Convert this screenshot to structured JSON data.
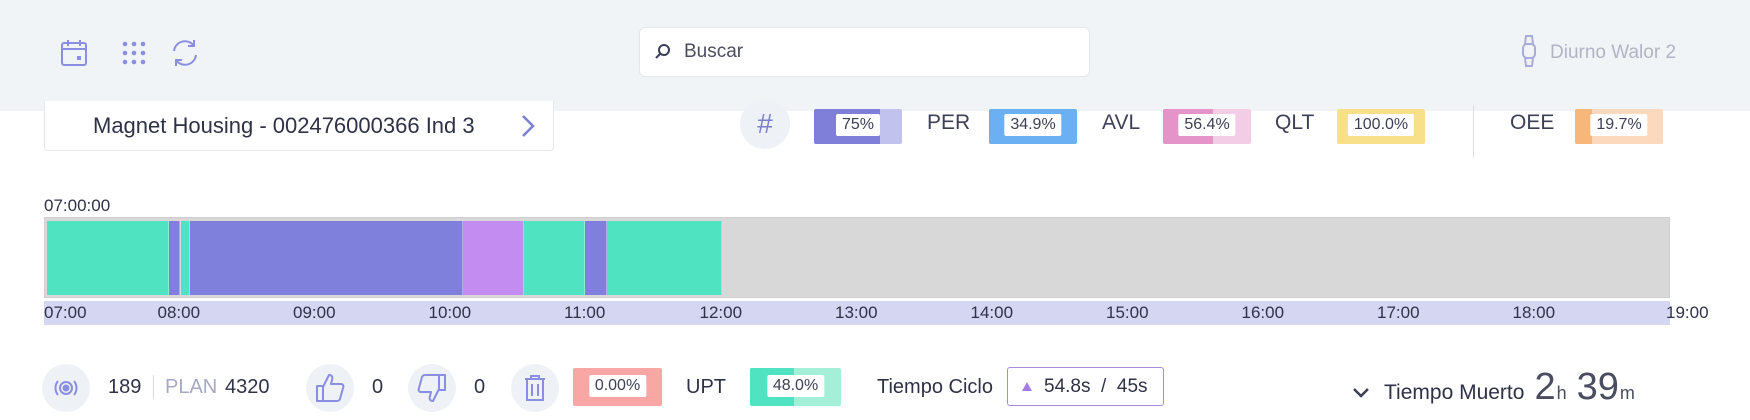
{
  "header": {
    "search_placeholder": "Buscar",
    "user_label": "Diurno Walor 2",
    "icons": [
      "calendar-icon",
      "grid-icon",
      "refresh-icon",
      "search-icon",
      "watch-icon"
    ]
  },
  "product": {
    "name": "Magnet Housing - 002476000366 Ind 3"
  },
  "kpis": {
    "hash_symbol": "#",
    "main": {
      "value": "75%",
      "fill_fraction": 0.75,
      "color": "#7f7fd9",
      "bg": "#c1c2ee"
    },
    "per": {
      "label": "PER",
      "value": "34.9%",
      "color": "#6ab0f3",
      "bg": "#6ab0f3"
    },
    "avl": {
      "label": "AVL",
      "value": "56.4%",
      "fill_fraction": 0.564,
      "color": "#e494c9",
      "bg": "#f3cde6"
    },
    "qlt": {
      "label": "QLT",
      "value": "100.0%",
      "fill_fraction": 1.0,
      "color": "#f8e08a",
      "bg": "#f8e08a"
    },
    "oee": {
      "label": "OEE",
      "value": "19.7%",
      "fill_fraction": 0.197,
      "color": "#f7b67a",
      "bg": "#fcd9bd"
    }
  },
  "timeline": {
    "start_label": "07:00:00",
    "ticks": [
      "07:00",
      "08:00",
      "09:00",
      "10:00",
      "11:00",
      "12:00",
      "13:00",
      "14:00",
      "15:00",
      "16:00",
      "17:00",
      "18:00",
      "19:00"
    ],
    "colors": {
      "running": "#4fe3c1",
      "stop": "#7e80dc",
      "setup": "#c28cf0",
      "empty": "#d8d8d8"
    },
    "segments": [
      {
        "state": "running",
        "start": "07:00",
        "end": "07:55"
      },
      {
        "state": "stop",
        "start": "07:55",
        "end": "08:00"
      },
      {
        "state": "running",
        "start": "08:00",
        "end": "08:04"
      },
      {
        "state": "stop",
        "start": "08:04",
        "end": "10:05"
      },
      {
        "state": "setup",
        "start": "10:05",
        "end": "10:32"
      },
      {
        "state": "running",
        "start": "10:32",
        "end": "10:59"
      },
      {
        "state": "stop",
        "start": "10:59",
        "end": "11:09"
      },
      {
        "state": "running",
        "start": "11:09",
        "end": "12:00"
      }
    ]
  },
  "footer": {
    "count": "189",
    "plan_label": "PLAN",
    "plan_value": "4320",
    "good_count": "0",
    "bad_count": "0",
    "scrap_value": "0.00%",
    "upt_label": "UPT",
    "upt_value": "48.0%",
    "upt_fill_fraction": 0.48,
    "ciclo_label": "Tiempo Ciclo",
    "ciclo_value": "54.8s  /  45s",
    "dead_label": "Tiempo Muerto",
    "dead_hours": "2",
    "dead_hours_unit": "h",
    "dead_minutes": "39",
    "dead_minutes_unit": "m"
  }
}
